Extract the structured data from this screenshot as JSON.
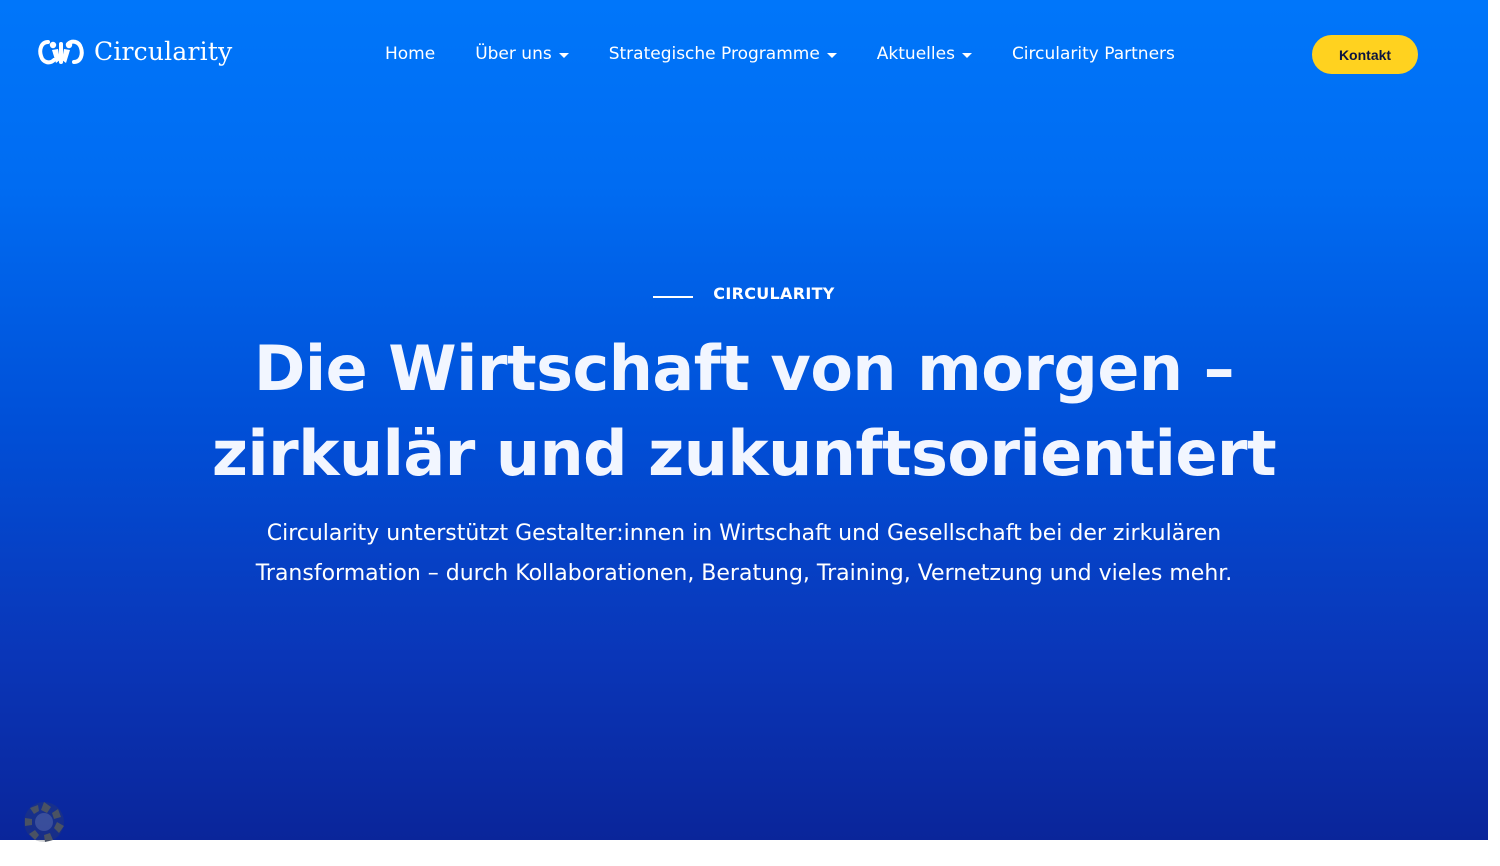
{
  "brand": {
    "name": "Circularity",
    "logo_icon": "circularity-logo-icon"
  },
  "nav": {
    "items": [
      {
        "label": "Home",
        "has_dropdown": false
      },
      {
        "label": "Über uns",
        "has_dropdown": true
      },
      {
        "label": "Strategische Programme",
        "has_dropdown": true
      },
      {
        "label": "Aktuelles",
        "has_dropdown": true
      },
      {
        "label": "Circularity Partners",
        "has_dropdown": false
      }
    ],
    "dropdown_icon": "caret-down-icon"
  },
  "cta": {
    "label": "Kontakt"
  },
  "hero": {
    "eyebrow": "CIRCULARITY",
    "headline_line1": "Die Wirtschaft von morgen –",
    "headline_line2": "zirkulär und zukunftsorientiert",
    "subtext_line1": "Circularity unterstützt Gestalter:innen in Wirtschaft und Gesellschaft bei der zirkulären",
    "subtext_line2": "Transformation – durch Kollaborationen, Beratung, Training, Vernetzung und vieles mehr."
  },
  "floating_widget": {
    "icon": "recycle-icon"
  },
  "colors": {
    "hero_top": "#0076fa",
    "hero_bottom": "#0a259a",
    "cta_background": "#ffd21f",
    "cta_text": "#0b1440",
    "text": "#ffffff"
  }
}
